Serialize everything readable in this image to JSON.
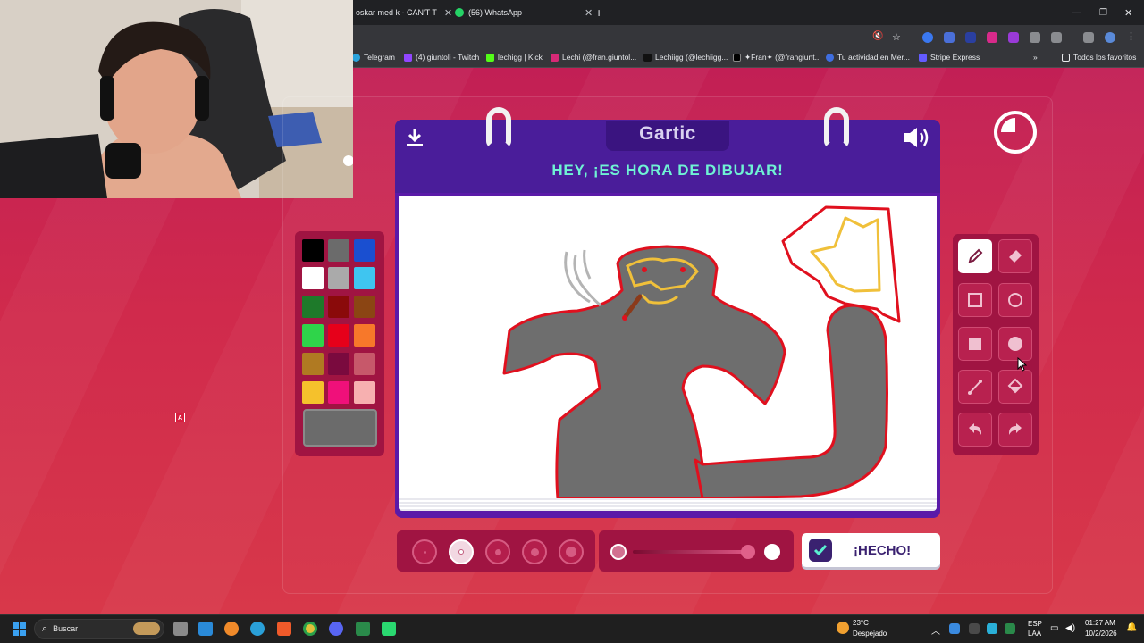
{
  "browser": {
    "tabs": [
      {
        "title": "oskar med k - CAN'T T"
      },
      {
        "title": "(56) WhatsApp"
      }
    ],
    "bookmarks": [
      {
        "label": "Telegram",
        "color": "#2aa3dc"
      },
      {
        "label": "(4) giuntoli - Twitch",
        "color": "#9146ff"
      },
      {
        "label": "lechigg | Kick",
        "color": "#53fc18"
      },
      {
        "label": "Lechi (@fran.giuntol...",
        "color": "#d62976"
      },
      {
        "label": "Lechiigg (@lechiigg...",
        "color": "#111111"
      },
      {
        "label": "✦Fran✦ (@frangiunt...",
        "color": "#000000"
      },
      {
        "label": "Tu actividad en Mer...",
        "color": "#3f6ee0"
      },
      {
        "label": "Stripe Express",
        "color": "#635bff"
      }
    ],
    "all_bookmarks_label": "Todos los favoritos"
  },
  "game": {
    "logo": "Gartic",
    "headline": "HEY, ¡ES HORA DE DIBUJAR!",
    "done_label": "¡HECHO!",
    "palette": [
      "#000000",
      "#6b6b6b",
      "#1a4fd0",
      "#ffffff",
      "#aaaaaa",
      "#3fc5f0",
      "#1e7a2a",
      "#8a0a0a",
      "#8b4513",
      "#2fd44a",
      "#e6001a",
      "#f7782a",
      "#b07a22",
      "#7a0a3e",
      "#c7586a",
      "#f5c12c",
      "#f0107a",
      "#f7b0b0"
    ],
    "current_color": "#6b6b6b",
    "tools": [
      "pencil-tool",
      "eraser-tool",
      "rectangle-outline-tool",
      "circle-outline-tool",
      "rectangle-fill-tool",
      "circle-fill-tool",
      "line-tool",
      "fill-bucket-tool",
      "undo-tool",
      "redo-tool"
    ],
    "selected_tool": "pencil-tool",
    "thickness_options": 5,
    "selected_thickness": 2
  },
  "webcam_marker": "A",
  "taskbar": {
    "search_placeholder": "Buscar",
    "weather_temp": "23°C",
    "weather_desc": "Despejado",
    "lang_top": "ESP",
    "lang_bottom": "LAA",
    "time": "01:27 AM",
    "date": "10/2/2026"
  }
}
